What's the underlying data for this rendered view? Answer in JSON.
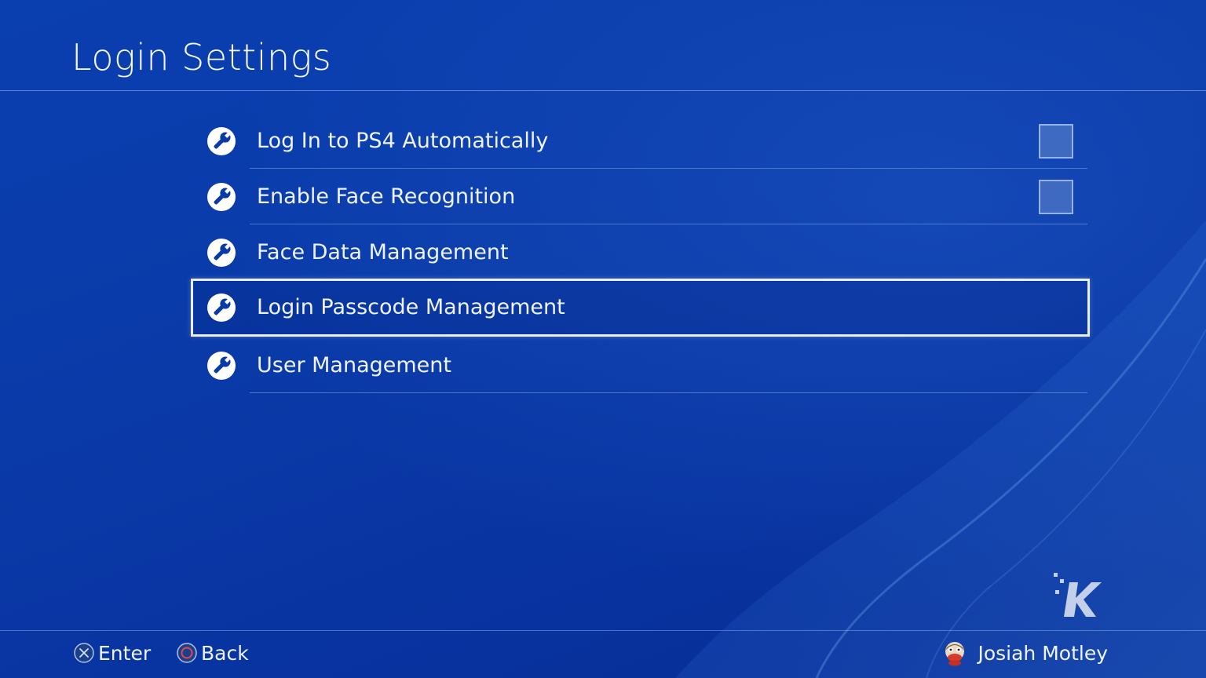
{
  "header": {
    "title": "Login Settings"
  },
  "menu": {
    "items": [
      {
        "label": "Log In to PS4 Automatically",
        "icon": "wrench-icon",
        "has_checkbox": true,
        "checked": false
      },
      {
        "label": "Enable Face Recognition",
        "icon": "wrench-icon",
        "has_checkbox": true,
        "checked": false
      },
      {
        "label": "Face Data Management",
        "icon": "wrench-icon",
        "has_checkbox": false
      },
      {
        "label": "Login Passcode Management",
        "icon": "wrench-icon",
        "has_checkbox": false,
        "selected": true
      },
      {
        "label": "User Management",
        "icon": "wrench-icon",
        "has_checkbox": false
      }
    ]
  },
  "footer": {
    "enter_label": "Enter",
    "enter_icon": "cross-button-icon",
    "back_label": "Back",
    "back_icon": "circle-button-icon",
    "user_name": "Josiah Motley",
    "user_avatar": "avatar-icon"
  },
  "colors": {
    "background": "#0a3aa8",
    "text": "#eef3ff",
    "selection_border": "#e9eef8",
    "circle_button": "#e0484a"
  }
}
